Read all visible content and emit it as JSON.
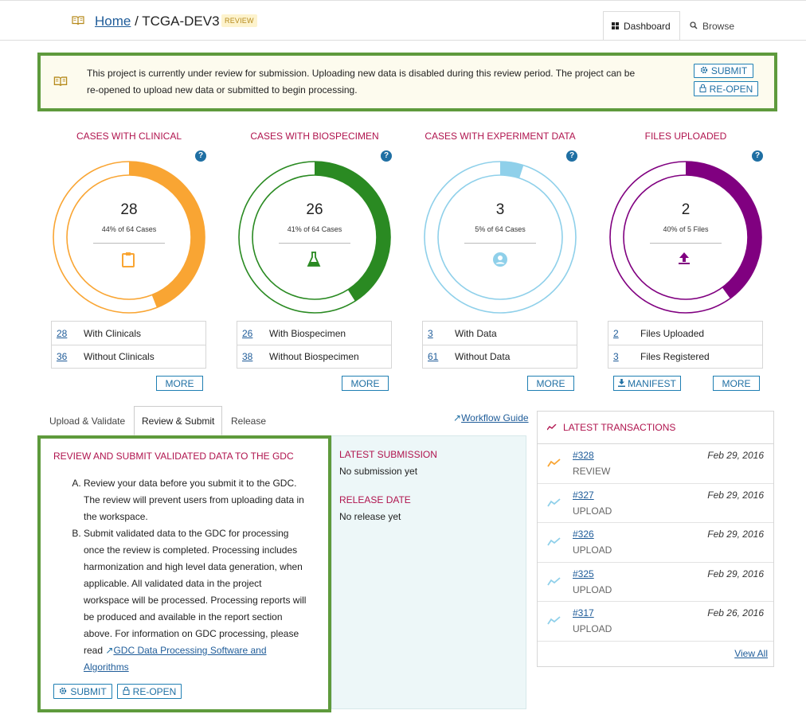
{
  "header": {
    "home_label": "Home",
    "separator": "/",
    "project": "TCGA-DEV3",
    "badge": "REVIEW",
    "tabs": [
      {
        "label": "Dashboard",
        "icon": "dashboard-icon",
        "active": true
      },
      {
        "label": "Browse",
        "icon": "search-icon",
        "active": false
      }
    ]
  },
  "banner": {
    "message": "This project is currently under review for submission. Uploading new data is disabled during this review period. The project can be re-opened to upload new data or submitted to begin processing.",
    "submit_label": "SUBMIT",
    "reopen_label": "RE-OPEN"
  },
  "stats": [
    {
      "title": "CASES WITH CLINICAL",
      "count": "28",
      "subtitle": "44% of 64 Cases",
      "percent": 44,
      "color": "#f9a533",
      "icon": "clipboard-icon",
      "rows": [
        {
          "num": "28",
          "label": "With Clinicals"
        },
        {
          "num": "36",
          "label": "Without Clinicals"
        }
      ],
      "more_label": "MORE"
    },
    {
      "title": "CASES WITH BIOSPECIMEN",
      "count": "26",
      "subtitle": "41% of 64 Cases",
      "percent": 41,
      "color": "#2a8a22",
      "icon": "flask-icon",
      "rows": [
        {
          "num": "26",
          "label": "With Biospecimen"
        },
        {
          "num": "38",
          "label": "Without Biospecimen"
        }
      ],
      "more_label": "MORE"
    },
    {
      "title": "CASES WITH EXPERIMENT DATA",
      "count": "3",
      "subtitle": "5% of 64 Cases",
      "percent": 5,
      "color": "#8fd0ea",
      "icon": "user-circle-icon",
      "rows": [
        {
          "num": "3",
          "label": "With Data"
        },
        {
          "num": "61",
          "label": "Without Data"
        }
      ],
      "more_label": "MORE"
    },
    {
      "title": "FILES UPLOADED",
      "count": "2",
      "subtitle": "40% of 5 Files",
      "percent": 40,
      "color": "#800080",
      "icon": "upload-icon",
      "rows": [
        {
          "num": "2",
          "label": "Files Uploaded"
        },
        {
          "num": "3",
          "label": "Files Registered"
        }
      ],
      "more_label": "MORE",
      "manifest_label": "MANIFEST"
    }
  ],
  "lower_tabs": [
    "Upload & Validate",
    "Review & Submit",
    "Release"
  ],
  "workflow_label": "Workflow Guide",
  "review": {
    "title": "REVIEW AND SUBMIT VALIDATED DATA TO THE GDC",
    "item_a": "Review your data before you submit it to the GDC. The review will prevent users from uploading data in the workspace.",
    "item_b": "Submit validated data to the GDC for processing once the review is completed. Processing includes harmonization and high level data generation, when applicable. All validated data in the project workspace will be processed. Processing reports will be produced and available in the report section above. For information on GDC processing, please read",
    "link": "GDC Data Processing Software and Algorithms",
    "submit_label": "SUBMIT",
    "reopen_label": "RE-OPEN"
  },
  "submission": {
    "latest_label": "LATEST SUBMISSION",
    "latest_value": "No submission yet",
    "release_label": "RELEASE DATE",
    "release_value": "No release yet"
  },
  "transactions": {
    "title": "LATEST TRANSACTIONS",
    "items": [
      {
        "id": "#328",
        "type": "REVIEW",
        "date": "Feb 29, 2016",
        "color": "#f9a533"
      },
      {
        "id": "#327",
        "type": "UPLOAD",
        "date": "Feb 29, 2016",
        "color": "#8fd0ea"
      },
      {
        "id": "#326",
        "type": "UPLOAD",
        "date": "Feb 29, 2016",
        "color": "#8fd0ea"
      },
      {
        "id": "#325",
        "type": "UPLOAD",
        "date": "Feb 29, 2016",
        "color": "#8fd0ea"
      },
      {
        "id": "#317",
        "type": "UPLOAD",
        "date": "Feb 26, 2016",
        "color": "#8fd0ea"
      }
    ],
    "view_all": "View All"
  }
}
